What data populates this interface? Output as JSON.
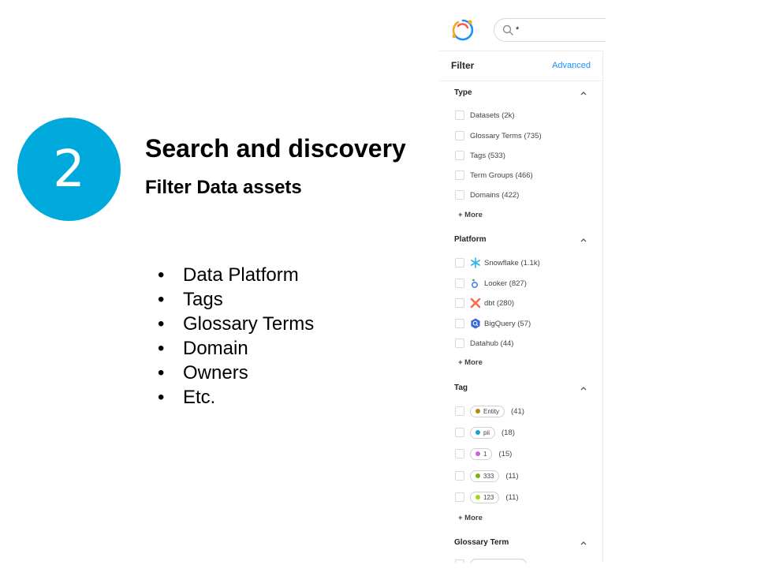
{
  "slide": {
    "step_number": "2",
    "title": "Search and discovery",
    "subtitle": "Filter Data assets",
    "bullets": [
      "Data Platform",
      "Tags",
      "Glossary Terms",
      "Domain",
      "Owners",
      "Etc."
    ],
    "circle_color": "#00a9dc"
  },
  "app": {
    "search": {
      "value": "*"
    },
    "filter": {
      "label": "Filter",
      "advanced_label": "Advanced",
      "accent_color": "#1890ff"
    },
    "sections": {
      "type": {
        "title": "Type",
        "items": [
          "Datasets (2k)",
          "Glossary Terms (735)",
          "Tags (533)",
          "Term Groups (466)",
          "Domains (422)"
        ],
        "more": "+ More"
      },
      "platform": {
        "title": "Platform",
        "items": [
          {
            "label": "Snowflake (1.1k)",
            "icon": "snowflake-icon"
          },
          {
            "label": "Looker (827)",
            "icon": "looker-icon"
          },
          {
            "label": "dbt (280)",
            "icon": "dbt-icon"
          },
          {
            "label": "BigQuery (57)",
            "icon": "bigquery-icon"
          },
          {
            "label": "Datahub (44)",
            "icon": ""
          }
        ],
        "more": "+ More"
      },
      "tag": {
        "title": "Tag",
        "items": [
          {
            "name": "Entity",
            "count": "(41)",
            "color": "#b8860b"
          },
          {
            "name": "pii",
            "count": "(18)",
            "color": "#1aa0d8"
          },
          {
            "name": "1",
            "count": "(15)",
            "color": "#d25be0"
          },
          {
            "name": "333",
            "count": "(11)",
            "color": "#7cb305"
          },
          {
            "name": "123",
            "count": "(11)",
            "color": "#a0d911"
          }
        ],
        "more": "+ More"
      },
      "glossary": {
        "title": "Glossary Term"
      }
    }
  }
}
